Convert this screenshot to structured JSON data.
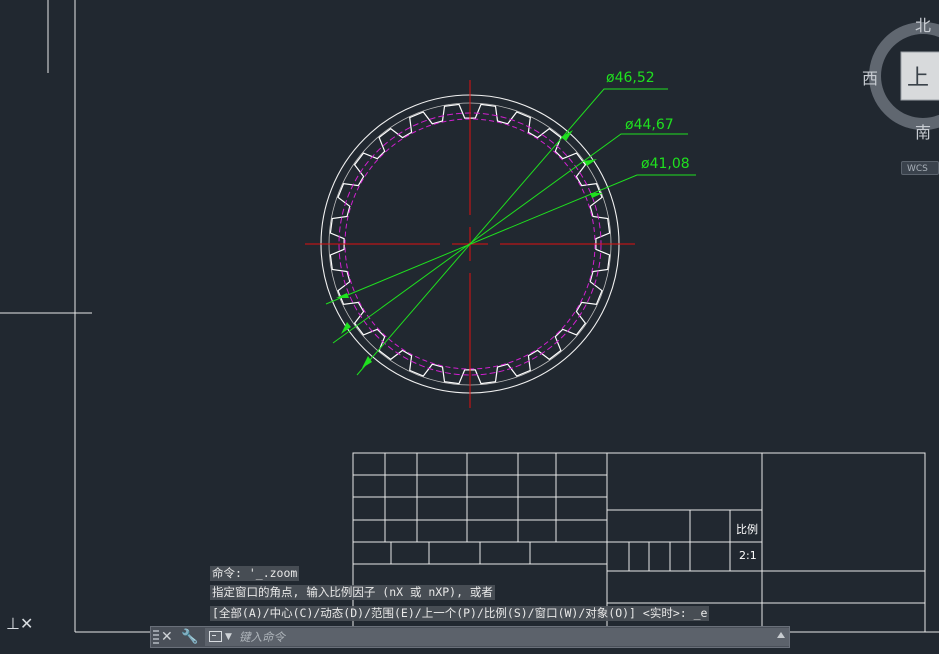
{
  "drawing": {
    "dimensions": [
      "ø46,52",
      "ø44,67",
      "ø41,08"
    ]
  },
  "viewcube": {
    "north": "北",
    "south": "南",
    "west": "西",
    "face": "上",
    "wcs": "WCS"
  },
  "title_block": {
    "scale_label": "比例",
    "scale_value": "2:1"
  },
  "command": {
    "history": [
      "命令: '_.zoom",
      "指定窗口的角点, 输入比例因子 (nX 或 nXP), 或者",
      "[全部(A)/中心(C)/动态(D)/范围(E)/上一个(P)/比例(S)/窗口(W)/对象(O)] <实时>: _e"
    ],
    "input_placeholder": "键入命令",
    "close_glyph": "✕",
    "tools_glyph": "🔧"
  },
  "colors": {
    "background": "#212830",
    "dimension": "#1fe01f",
    "centerline": "#e01010",
    "hidden_circle": "#d020d0",
    "geometry": "#ffffff"
  }
}
